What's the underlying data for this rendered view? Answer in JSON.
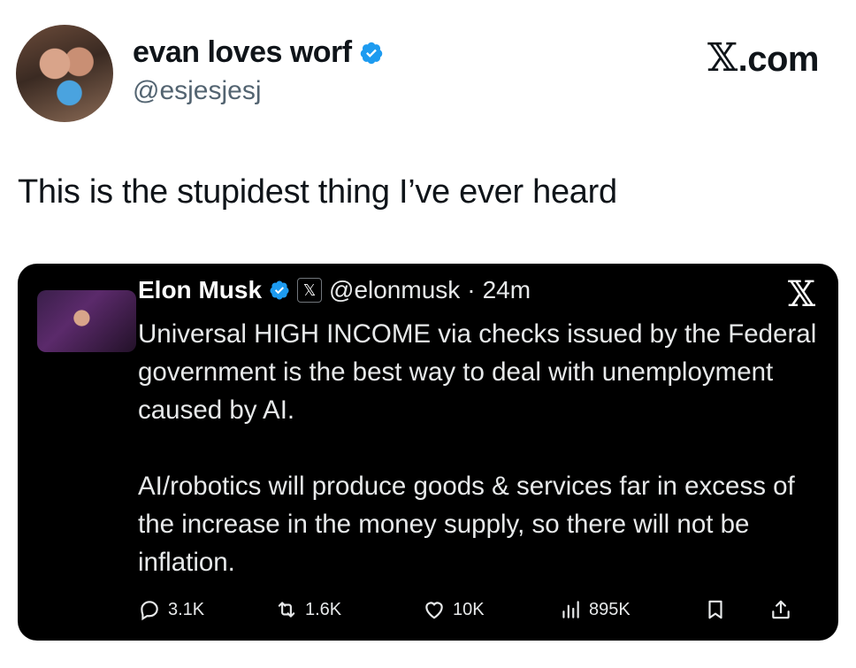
{
  "author": {
    "name": "evan loves worf",
    "handle": "@esjesjesj",
    "verified": true
  },
  "site_logo": {
    "mark": "𝕏",
    "text": ".com"
  },
  "tweet": {
    "text": "This is the stupidest thing I’ve ever heard"
  },
  "quoted": {
    "name": "Elon Musk",
    "badge": "𝕏",
    "handle": "@elonmusk",
    "separator": "·",
    "time": "24m",
    "close_mark": "𝕏",
    "paragraphs": [
      "Universal HIGH INCOME via checks issued by the Federal government is the best way to deal with unemployment caused by AI.",
      "AI/robotics will produce goods & services far in excess of the increase in the money supply, so there will not be inflation."
    ],
    "stats": {
      "replies": "3.1K",
      "reposts": "1.6K",
      "likes": "10K",
      "views": "895K"
    }
  },
  "colors": {
    "verified_blue": "#1d9bf0",
    "card_bg": "#000000",
    "muted": "#536471"
  }
}
